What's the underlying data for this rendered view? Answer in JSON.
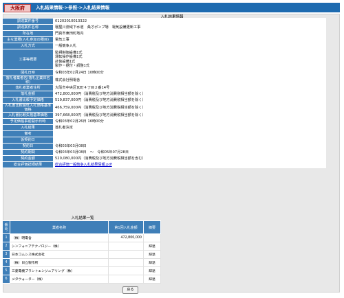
{
  "header": {
    "prefecture": "大阪府",
    "breadcrumb": "入札結果情報->参照->入札結果情報"
  },
  "detail_title": "入札結果情報",
  "detail": [
    {
      "label": "調達案件番号",
      "value": "01202010013322"
    },
    {
      "label": "調達案件名称",
      "value": "寝屋川流域下水道　桑才ポンプ場　電気設備更新工事"
    },
    {
      "label": "所在地",
      "value": "門真市東田町地内"
    },
    {
      "label": "主な業種(入札参加の種目)",
      "value": "電気工事"
    },
    {
      "label": "入札方式",
      "value": "一般競争入札"
    },
    {
      "label": "工事等概要",
      "value": "監視制御設備1式\n運転操作設備1式\n計装設備1式\n製作・据付・調整1式"
    },
    {
      "label": "開札日時",
      "value": "令和03年02月24日 10時00分"
    },
    {
      "label": "落札者業者名(落札企業体名称)",
      "value": "株式会社明電舎"
    },
    {
      "label": "落札者業者住所",
      "value": "大阪市中央区瓦町４丁目２番14号"
    },
    {
      "label": "落札金額",
      "value": "472,800,000円（消費税及び地方消費税相当額を除く）"
    },
    {
      "label": "入札書比較予定価格",
      "value": "519,837,000円（消費税及び地方消費税相当額を除く）"
    },
    {
      "label": "入札書比較最低入札価格基準価格",
      "value": "466,759,000円（消費税及び地方消費税相当額を除く）"
    },
    {
      "label": "入札書比較失格基準価格",
      "value": "397,668,000円（消費税及び地方消費税相当額を除く）"
    },
    {
      "label": "予定価格事前開示日時",
      "value": "令和03年02月26日 16時00分"
    },
    {
      "label": "入札結果",
      "value": "落札者決定"
    },
    {
      "label": "備考",
      "value": ""
    },
    {
      "label": "仮契約日",
      "value": ""
    },
    {
      "label": "契約日",
      "value": "令和03年03月08日"
    },
    {
      "label": "契約期間",
      "value": "令和03年03月08日　～　令和05年07月28日"
    },
    {
      "label": "契約金額",
      "value": "520,080,000円（消費税及び地方消費税相当額を含む）"
    },
    {
      "label": "総合評価詳細結果",
      "value": "総合評価一般競争入札結果情報.pdf",
      "link": true
    }
  ],
  "results_title": "入札結果一覧",
  "results_headers": [
    "番号",
    "業者名称",
    "第1回入札金額",
    "摘要"
  ],
  "results": [
    {
      "no": "1",
      "name": "（株）明電舎",
      "amount": "472,800,000",
      "note": ""
    },
    {
      "no": "2",
      "name": "シンフォニアテクノロジー（株）",
      "amount": "",
      "note": "辞退"
    },
    {
      "no": "3",
      "name": "日本コムシス株式会社",
      "amount": "",
      "note": "辞退"
    },
    {
      "no": "4",
      "name": "（株）日立製作所",
      "amount": "",
      "note": "辞退"
    },
    {
      "no": "5",
      "name": "三菱電機プラントエンジニアリング（株）",
      "amount": "",
      "note": "辞退"
    },
    {
      "no": "6",
      "name": "メタウォーター（株）",
      "amount": "",
      "note": "辞退"
    }
  ],
  "back_button": "戻る"
}
